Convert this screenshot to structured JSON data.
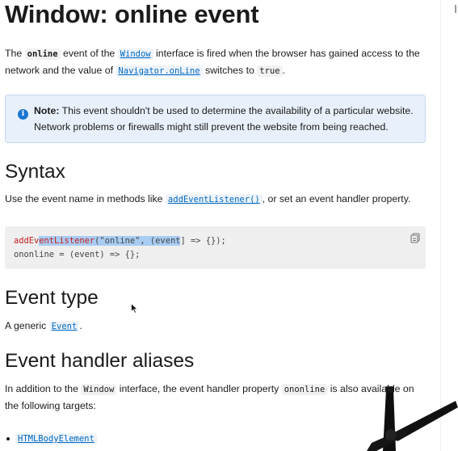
{
  "page_title": "Window: online event",
  "intro": {
    "p1": "The",
    "code_online": "online",
    "p2": "event of the",
    "link_window": "Window",
    "p3": "interface is fired when the browser has gained access to the network and the value of",
    "link_navigator": "Navigator.onLine",
    "p4": "switches to",
    "code_true": "true",
    "p5": "."
  },
  "note": {
    "label": "Note:",
    "text": "This event shouldn't be used to determine the availability of a particular website. Network problems or firewalls might still prevent the website from being reached."
  },
  "syntax": {
    "heading": "Syntax",
    "p1": "Use the event name in methods like",
    "link_addeventlistener": "addEventListener()",
    "p2": ", or set an event handler property.",
    "code_line1": {
      "fn_a": "addEv",
      "fn_sel": "entListener",
      "sel_rest": "(\"online\", (event",
      "after_sel": "] => {});"
    },
    "code_line2": "ononline = (event) => {};"
  },
  "event_type": {
    "heading": "Event type",
    "p1": "A generic",
    "link_event": "Event",
    "p2": "."
  },
  "aliases": {
    "heading": "Event handler aliases",
    "p1": "In addition to the",
    "code_window": "Window",
    "p2": "interface, the event handler property",
    "code_ononline": "ononline",
    "p3": "is also available on the following targets:",
    "targets": [
      "HTMLBodyElement"
    ]
  },
  "icons": [
    "info-icon",
    "copy-icon",
    "mouse-cursor-icon",
    "microphone-arm-icon"
  ]
}
